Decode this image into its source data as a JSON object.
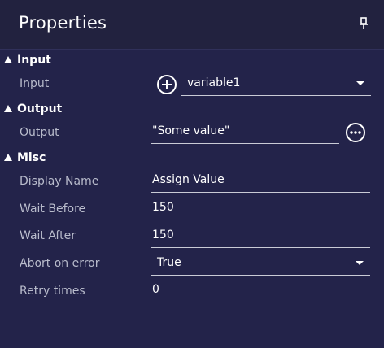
{
  "header": {
    "title": "Properties",
    "pin_icon": "pin-icon"
  },
  "sections": {
    "input": {
      "title": "Input",
      "row_label": "Input",
      "value": "variable1",
      "add_icon": "plus-circle-icon"
    },
    "output": {
      "title": "Output",
      "row_label": "Output",
      "value": "\"Some value\"",
      "more_icon": "ellipsis-circle-icon"
    },
    "misc": {
      "title": "Misc",
      "rows": [
        {
          "label": "Display Name",
          "value": "Assign Value"
        },
        {
          "label": "Wait Before",
          "value": "150"
        },
        {
          "label": "Wait After",
          "value": "150"
        },
        {
          "label": "Abort on error",
          "value": "True"
        },
        {
          "label": "Retry times",
          "value": "0"
        }
      ]
    }
  },
  "colors": {
    "background": "#23234a",
    "label": "#b9bccc",
    "text": "#ffffff",
    "underline": "#c9cbd6"
  }
}
